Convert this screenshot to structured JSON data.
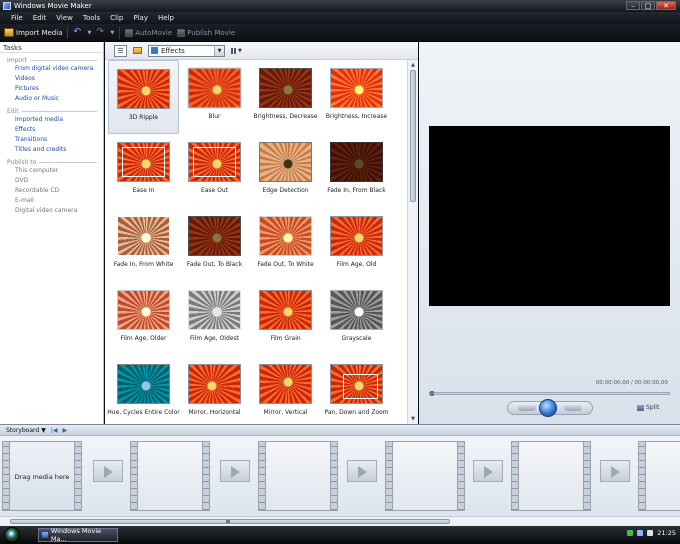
{
  "window": {
    "title": "Windows Movie Maker"
  },
  "menu": [
    "File",
    "Edit",
    "View",
    "Tools",
    "Clip",
    "Play",
    "Help"
  ],
  "toolbar": {
    "import": "Import Media",
    "automovie": "AutoMovie",
    "publish": "Publish Movie"
  },
  "tasks": {
    "title": "Tasks",
    "groups": [
      {
        "title": "Import",
        "items": [
          "From digital video camera",
          "Videos",
          "Pictures",
          "Audio or Music"
        ]
      },
      {
        "title": "Edit",
        "items": [
          "Imported media",
          "Effects",
          "Transitions",
          "Titles and credits"
        ]
      },
      {
        "title": "Publish to",
        "items": [
          "This computer",
          "DVD",
          "Recordable CD",
          "E-mail",
          "Digital video camera"
        ]
      }
    ]
  },
  "collection": {
    "selected": "Effects"
  },
  "effects": [
    "3D Ripple",
    "Blur",
    "Brightness, Decrease",
    "Brightness, Increase",
    "Ease In",
    "Ease Out",
    "Edge Detection",
    "Fade In, From Black",
    "Fade In, From White",
    "Fade Out, To Black",
    "Fade Out, To White",
    "Film Age, Old",
    "Film Age, Older",
    "Film Age, Oldest",
    "Film Grain",
    "Grayscale",
    "Hue, Cycles Entire Color",
    "Mirror, Horizontal",
    "Mirror, Vertical",
    "Pan, Down and Zoom"
  ],
  "selected_effect": "3D Ripple",
  "preview": {
    "timecode": "00:00:00,00 / 00:00:00,00",
    "split_label": "Split"
  },
  "storyboard": {
    "label": "Storyboard",
    "drag_hint": "Drag media here"
  },
  "taskbar": {
    "task_label": "Windows Movie Ma...",
    "clock": "21:25"
  },
  "colors": {
    "accent": "#1a4fa8",
    "monitor": "#000000"
  }
}
